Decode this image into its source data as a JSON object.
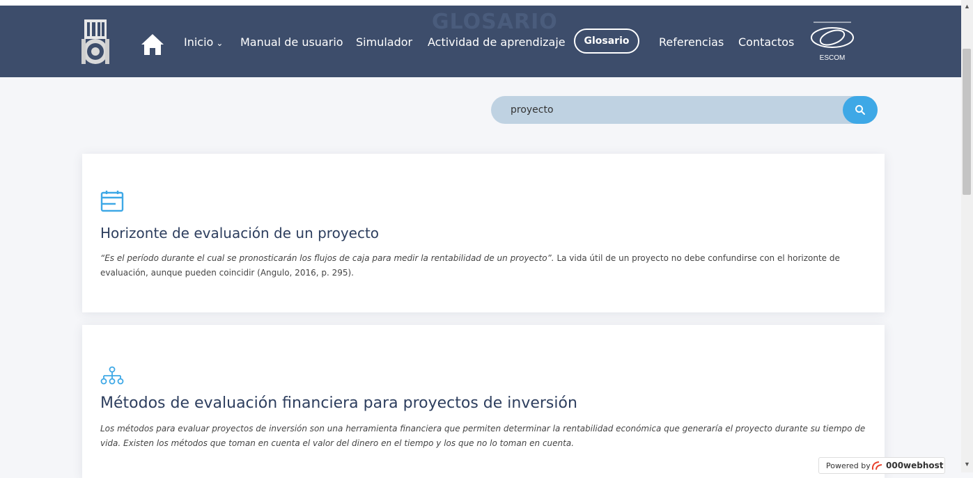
{
  "header": {
    "background_title": "GLOSARIO",
    "nav": {
      "home_icon": "home-icon",
      "items": [
        {
          "label": "Inicio",
          "has_dropdown": true
        },
        {
          "label": "Manual de usuario"
        },
        {
          "label": "Simulador"
        },
        {
          "label": "Actividad de aprendizaje"
        },
        {
          "label": "Glosario",
          "active": true
        },
        {
          "label": "Referencias"
        },
        {
          "label": "Contactos"
        }
      ],
      "dropdown_chevron": "⌄"
    },
    "logo_escom_text": "ESCOM"
  },
  "search": {
    "value": "proyecto",
    "button_icon": "search-icon"
  },
  "results": [
    {
      "icon": "calendar-card-icon",
      "title": "Horizonte de evaluación de un proyecto",
      "quote": "“Es el período durante el cual se pronosticarán los flujos de caja para medir la rentabilidad de un proyecto”.",
      "text": " La vida útil de un proyecto no debe confundirse con el horizonte de evaluación, aunque pueden coincidir (Angulo, 2016, p. 295)."
    },
    {
      "icon": "sitemap-icon",
      "title": "Métodos de evaluación financiera para proyectos de inversión",
      "text": "Los métodos para evaluar proyectos de inversión son una herramienta financiera que permiten determinar la rentabilidad económica que generaría el proyecto durante su tiempo de vida. Existen los métodos que toman en cuenta el valor del dinero en el tiempo y los que no lo toman en cuenta."
    }
  ],
  "footer_badge": {
    "powered_by": "Powered by",
    "host": "000webhost"
  },
  "colors": {
    "navbar": "#3d4d6b",
    "accent": "#3ea8e6",
    "search_bg": "#bfd2e2",
    "title": "#2d3e5e"
  }
}
